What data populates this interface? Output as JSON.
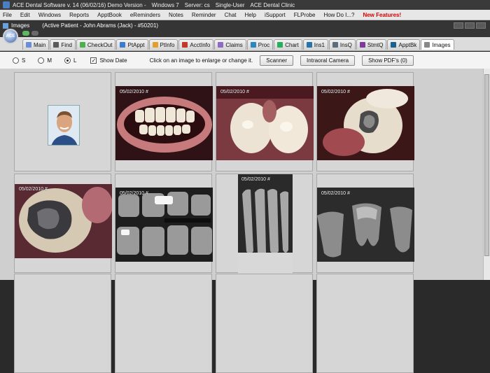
{
  "titlebar": {
    "app": "ACE Dental Software v. 14 (06/02/16) Demo Version -",
    "os": "Windows 7",
    "server": "Server: cs",
    "mode": "Single-User",
    "clinic": "ACE Dental Clinic"
  },
  "menu": [
    "File",
    "Edit",
    "Windows",
    "Reports",
    "ApptBook",
    "eReminders",
    "Notes",
    "Reminder",
    "Chat",
    "Help",
    "iSupport",
    "FLProbe",
    "How Do I...?",
    "New Features!"
  ],
  "window": {
    "title": "Images",
    "patient": "(Active Patient - John Abrams (Jack) - #50201)"
  },
  "tabs": [
    {
      "label": "Main",
      "color": "#6a8fd8"
    },
    {
      "label": "Find",
      "color": "#5a5a5a"
    },
    {
      "label": "CheckOut",
      "color": "#4caf50"
    },
    {
      "label": "PtAppt",
      "color": "#3b7bd1"
    },
    {
      "label": "PtInfo",
      "color": "#e0a030"
    },
    {
      "label": "AcctInfo",
      "color": "#c0392b"
    },
    {
      "label": "Claims",
      "color": "#8e6bc0"
    },
    {
      "label": "Proc",
      "color": "#2e86c1"
    },
    {
      "label": "Chart",
      "color": "#27ae60"
    },
    {
      "label": "Ins1",
      "color": "#2874a6"
    },
    {
      "label": "InsQ",
      "color": "#5d6d7e"
    },
    {
      "label": "StmtQ",
      "color": "#7d3c98"
    },
    {
      "label": "ApptBk",
      "color": "#1f618d"
    },
    {
      "label": "Images",
      "color": "#888888"
    }
  ],
  "options": {
    "sizes": [
      "S",
      "M",
      "L"
    ],
    "selected": "L",
    "show_date_label": "Show Date",
    "show_date_checked": true,
    "hint": "Click on an image to enlarge or change it.",
    "buttons": [
      "Scanner",
      "Intraoral Camera",
      "Show PDF's (0)"
    ]
  },
  "images": [
    {
      "kind": "portrait",
      "date": ""
    },
    {
      "kind": "smile",
      "date": "05/02/2010  #"
    },
    {
      "kind": "intraoral",
      "date": "05/02/2010  #"
    },
    {
      "kind": "filling",
      "date": "05/02/2010  #"
    },
    {
      "kind": "amalgam",
      "date": "05/02/2010  #"
    },
    {
      "kind": "xray-bw",
      "date": "05/02/2010  #"
    },
    {
      "kind": "xray-pa",
      "date": "05/02/2010  #"
    },
    {
      "kind": "xray-molar",
      "date": "05/02/2010  #"
    }
  ]
}
